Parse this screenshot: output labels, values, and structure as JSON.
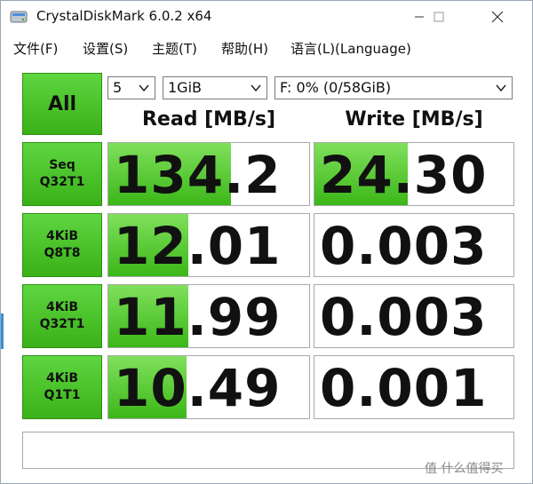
{
  "window": {
    "title": "CrystalDiskMark 6.0.2 x64"
  },
  "menu": {
    "items": [
      "文件(F)",
      "设置(S)",
      "主题(T)",
      "帮助(H)",
      "语言(L)(Language)"
    ]
  },
  "controls": {
    "all_label": "All",
    "count_value": "5",
    "size_value": "1GiB",
    "drive_value": "F: 0% (0/58GiB)"
  },
  "headers": {
    "read": "Read [MB/s]",
    "write": "Write [MB/s]"
  },
  "tests": [
    {
      "line1": "Seq",
      "line2": "Q32T1",
      "read": "134.2",
      "write": "24.30",
      "read_fill": 0.61,
      "write_fill": 0.47
    },
    {
      "line1": "4KiB",
      "line2": "Q8T8",
      "read": "12.01",
      "write": "0.003",
      "read_fill": 0.4,
      "write_fill": 0.0
    },
    {
      "line1": "4KiB",
      "line2": "Q32T1",
      "read": "11.99",
      "write": "0.003",
      "read_fill": 0.4,
      "write_fill": 0.0
    },
    {
      "line1": "4KiB",
      "line2": "Q1T1",
      "read": "10.49",
      "write": "0.001",
      "read_fill": 0.39,
      "write_fill": 0.0
    }
  ],
  "status": "",
  "watermark": "值 什么值得买"
}
